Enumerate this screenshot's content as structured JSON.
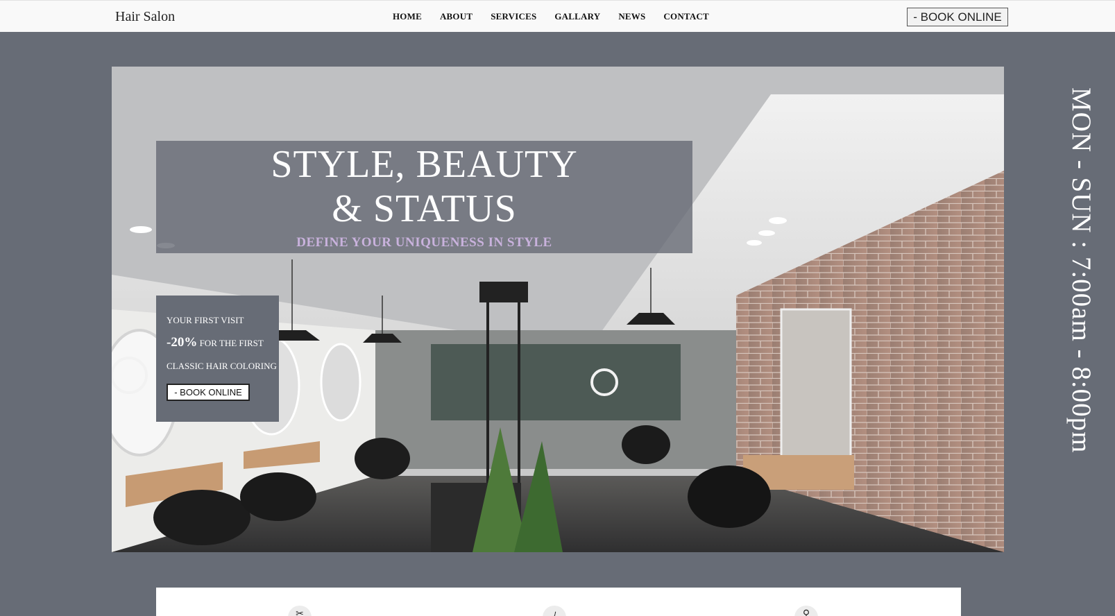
{
  "header": {
    "logo": "Hair Salon",
    "nav": [
      "HOME",
      "ABOUT",
      "SERVICES",
      "GALLARY",
      "NEWS",
      "CONTACT"
    ],
    "book_label": "- BOOK ONLINE"
  },
  "hero": {
    "headline_line1": "STYLE, BEAUTY",
    "headline_line2": "& STATUS",
    "tagline": "DEFINE YOUR UNIQUENESS IN STYLE"
  },
  "offer": {
    "line1": "YOUR FIRST VISIT",
    "discount": "-20%",
    "line2_rest": " FOR THE FIRST",
    "line3": "CLASSIC HAIR COLORING",
    "button": "- BOOK ONLINE"
  },
  "hours": "MON - SUN : 7:00am - 8:00pm",
  "features": {
    "icons": [
      "scissors-icon",
      "comb-icon",
      "pin-icon"
    ]
  },
  "colors": {
    "background": "#676c76",
    "header_bg": "#f9f9f9",
    "tagline": "#c9b2dd",
    "overlay": "#646872"
  }
}
